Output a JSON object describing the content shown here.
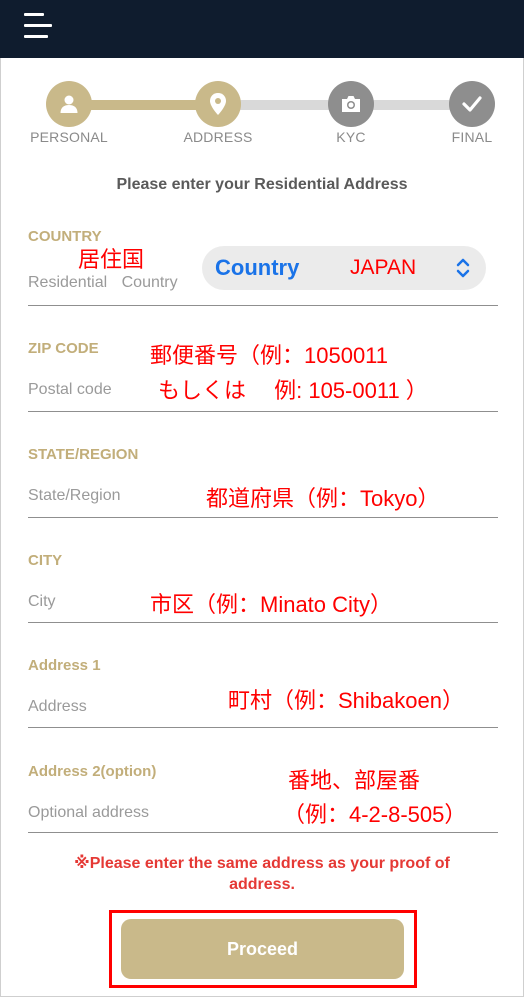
{
  "header": {
    "menu_icon": "hamburger-menu-icon"
  },
  "stepper": {
    "steps": [
      {
        "label": "PERSONAL",
        "icon": "person-icon",
        "state": "complete"
      },
      {
        "label": "ADDRESS",
        "icon": "location-pin-icon",
        "state": "current"
      },
      {
        "label": "KYC",
        "icon": "camera-icon",
        "state": "pending"
      },
      {
        "label": "FINAL",
        "icon": "checkmark-icon",
        "state": "pending"
      }
    ]
  },
  "form": {
    "heading": "Please enter your Residential Address",
    "country": {
      "label": "COUNTRY",
      "annotation": "居住国",
      "placeholder_parts": [
        "Residential",
        "Country"
      ],
      "select_placeholder": "Country",
      "select_value": "JAPAN"
    },
    "zip": {
      "label": "ZIP CODE",
      "placeholder": "Postal code",
      "annotation_line1": "郵便番号（例：1050011",
      "annotation_line2": "もしくは　 例: 105-0011 ）"
    },
    "state": {
      "label": "STATE/REGION",
      "placeholder": "State/Region",
      "annotation": "都道府県（例：Tokyo）"
    },
    "city": {
      "label": "CITY",
      "placeholder": "City",
      "annotation": "市区（例：Minato City）"
    },
    "address1": {
      "label": "Address 1",
      "placeholder": "Address",
      "annotation": "町村（例：Shibakoen）"
    },
    "address2": {
      "label": "Address 2(option)",
      "placeholder": "Optional address",
      "annotation_line1": "番地、部屋番",
      "annotation_line2": "（例：4-2-8-505）"
    }
  },
  "notice": {
    "line1": "※Please enter the same address as your proof of",
    "line2": "address."
  },
  "proceed_label": "Proceed",
  "colors": {
    "topbar": "#0f1c2e",
    "gold": "#c9b98a",
    "label_gold": "#c2ae7a",
    "inactive_step": "#8e8e8e",
    "annotation_red": "#ff0000",
    "notice_red": "#e53935",
    "select_blue": "#1a73e8"
  }
}
